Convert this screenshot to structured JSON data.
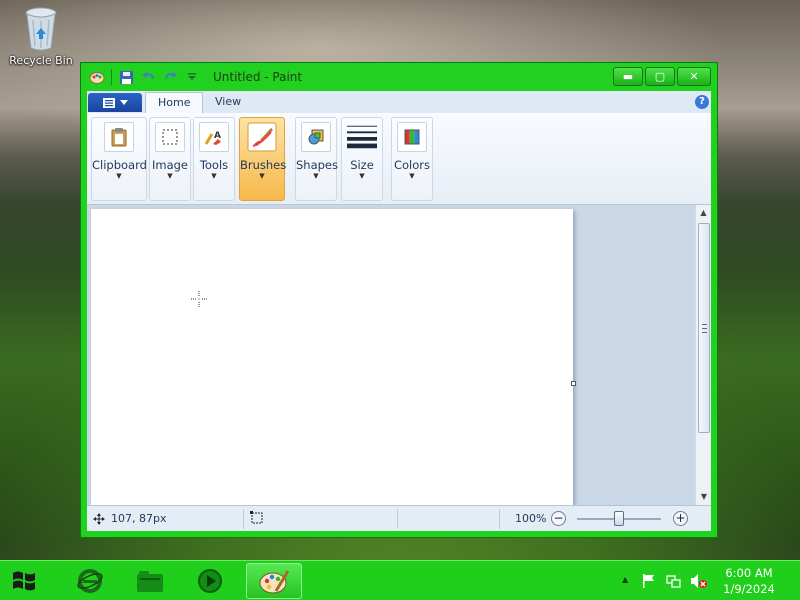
{
  "desktop": {
    "recycle_bin_label": "Recycle Bin"
  },
  "window": {
    "title": "Untitled - Paint",
    "minimize_glyph": "▬",
    "maximize_glyph": "▢",
    "close_glyph": "✕",
    "help_glyph": "?"
  },
  "tabs": [
    {
      "label": "Home",
      "active": true
    },
    {
      "label": "View",
      "active": false
    }
  ],
  "ribbon": {
    "groups": [
      {
        "label": "Clipboard",
        "icon": "clipboard-icon"
      },
      {
        "label": "Image",
        "icon": "selection-icon"
      },
      {
        "label": "Tools",
        "icon": "tools-icon"
      },
      {
        "label": "Brushes",
        "icon": "brush-icon",
        "active": true
      },
      {
        "label": "Shapes",
        "icon": "shapes-icon"
      },
      {
        "label": "Size",
        "icon": "line-size-icon"
      },
      {
        "label": "Colors",
        "icon": "color-palette-icon"
      }
    ]
  },
  "statusbar": {
    "cursor_position": "107, 87px",
    "zoom_level": "100%",
    "zoom_out_glyph": "−",
    "zoom_in_glyph": "+",
    "zoom_fraction": 0.5
  },
  "taskbar": {
    "clock_time": "6:00 AM",
    "clock_date": "1/9/2024",
    "items": [
      "internet-explorer-icon",
      "file-explorer-icon",
      "media-player-icon",
      "paint-icon"
    ]
  },
  "colors": {
    "window_frame": "#22d11f",
    "taskbar": "#20cf1c",
    "active_group": "#f7b84b"
  }
}
